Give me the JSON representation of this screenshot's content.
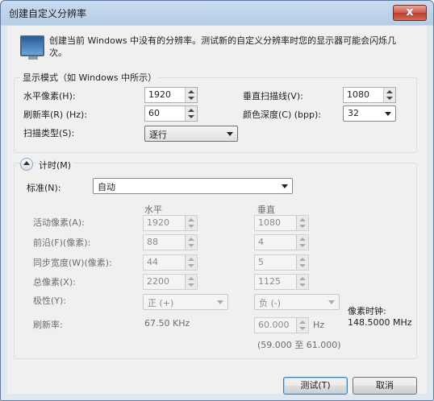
{
  "window": {
    "title": "创建自定义分辨率",
    "close_glyph": "x"
  },
  "info": {
    "text": "创建当前 Windows 中没有的分辨率。测试新的自定义分辨率时您的显示器可能会闪烁几次。",
    "icon": "monitor-icon"
  },
  "display_mode": {
    "legend": "显示模式（如 Windows 中所示）",
    "h_pixels_label": "水平像素(H):",
    "h_pixels_value": "1920",
    "v_lines_label": "垂直扫描线(V):",
    "v_lines_value": "1080",
    "refresh_label": "刷新率(R) (Hz):",
    "refresh_value": "60",
    "color_depth_label": "颜色深度(C) (bpp):",
    "color_depth_value": "32",
    "scan_type_label": "扫描类型(S):",
    "scan_type_value": "逐行"
  },
  "timing": {
    "legend": "计时(M)",
    "standard_label": "标准(N):",
    "standard_value": "自动",
    "col_horizontal": "水平",
    "col_vertical": "垂直",
    "active_label": "活动像素(A):",
    "active_h": "1920",
    "active_v": "1080",
    "front_porch_label": "前沿(F)(像素):",
    "front_porch_h": "88",
    "front_porch_v": "4",
    "sync_width_label": "同步宽度(W)(像素):",
    "sync_width_h": "44",
    "sync_width_v": "5",
    "total_label": "总像素(X):",
    "total_h": "2200",
    "total_v": "1125",
    "polarity_label": "极性(Y):",
    "polarity_h": "正 (+)",
    "polarity_v": "负 (-)",
    "pixel_clock_label": "像素时钟:",
    "pixel_clock_value": "148.5000 MHz",
    "refresh_label": "刷新率:",
    "refresh_h": "67.50 KHz",
    "refresh_v": "60.000",
    "refresh_v_unit": "Hz",
    "refresh_range": "(59.000 至 61.000)"
  },
  "buttons": {
    "test": "测试(T)",
    "cancel": "取消"
  },
  "colors": {
    "titlebar": "#c8dbef",
    "client": "#f0f0f0",
    "close": "#c9564a"
  }
}
